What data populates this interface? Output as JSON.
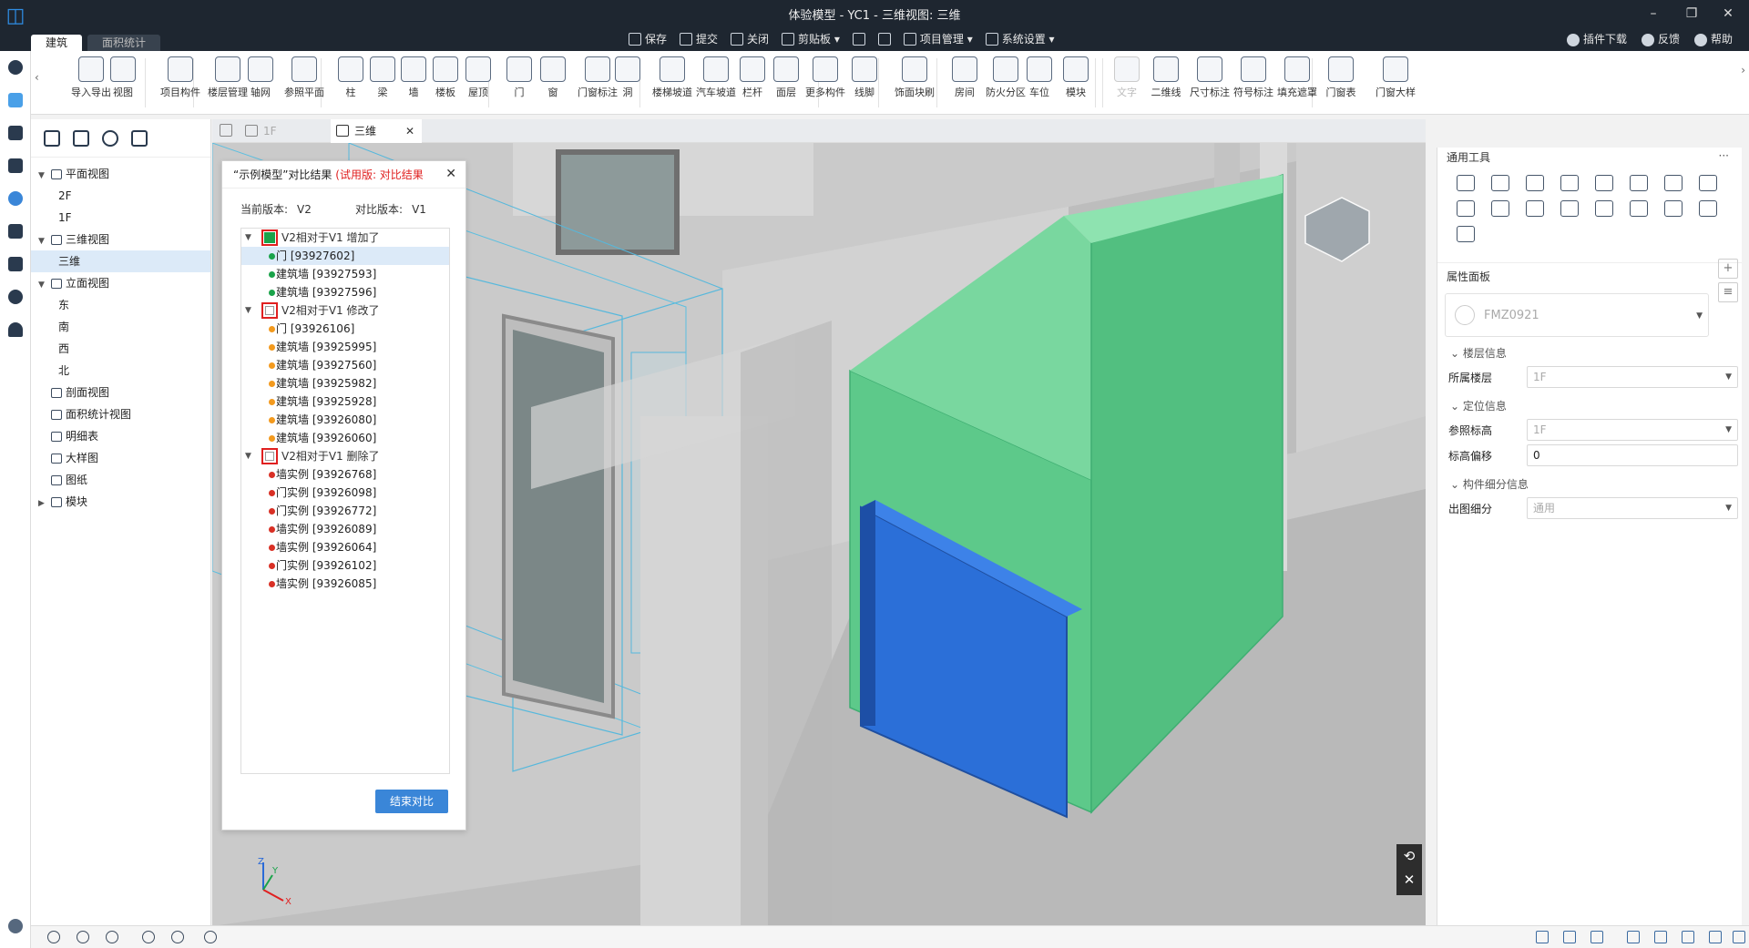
{
  "window": {
    "title": "体验模型 - YC1 - 三维视图: 三维",
    "app_tabs": [
      "建筑",
      "面积统计"
    ]
  },
  "quickbar": [
    {
      "label": "保存",
      "icon": "save-icon"
    },
    {
      "label": "提交",
      "icon": "submit-icon"
    },
    {
      "label": "关闭",
      "icon": "close-file-icon"
    },
    {
      "label": "剪贴板 ▾",
      "icon": "clipboard-icon"
    },
    {
      "label": "",
      "icon": "undo-icon"
    },
    {
      "label": "",
      "icon": "redo-icon"
    },
    {
      "label": "项目管理 ▾",
      "icon": "project-icon"
    },
    {
      "label": "系统设置 ▾",
      "icon": "settings-icon"
    }
  ],
  "right_links": [
    "插件下载",
    "反馈",
    "帮助"
  ],
  "ribbon": {
    "items": [
      "导入导出",
      "视图",
      "项目构件",
      "楼层管理",
      "轴网",
      "参照平面",
      "柱",
      "梁",
      "墙",
      "楼板",
      "屋顶",
      "门",
      "窗",
      "门窗标注",
      "洞",
      "楼梯坡道",
      "汽车坡道",
      "栏杆",
      "面层",
      "更多构件",
      "线脚",
      "饰面块刷",
      "房间",
      "防火分区",
      "车位",
      "模块",
      "文字",
      "二维线",
      "尺寸标注",
      "符号标注",
      "填充遮罩",
      "门窗表",
      "门窗大样"
    ],
    "disabled": [
      "文字"
    ]
  },
  "tree": {
    "nodes": [
      {
        "label": "平面视图",
        "level": 0,
        "arrow": "▼"
      },
      {
        "label": "2F",
        "level": 1
      },
      {
        "label": "1F",
        "level": 1
      },
      {
        "label": "三维视图",
        "level": 0,
        "arrow": "▼"
      },
      {
        "label": "三维",
        "level": 1,
        "selected": true
      },
      {
        "label": "立面视图",
        "level": 0,
        "arrow": "▼"
      },
      {
        "label": "东",
        "level": 1
      },
      {
        "label": "南",
        "level": 1
      },
      {
        "label": "西",
        "level": 1
      },
      {
        "label": "北",
        "level": 1
      },
      {
        "label": "剖面视图",
        "level": 0
      },
      {
        "label": "面积统计视图",
        "level": 0
      },
      {
        "label": "明细表",
        "level": 0
      },
      {
        "label": "大样图",
        "level": 0
      },
      {
        "label": "图纸",
        "level": 0
      },
      {
        "label": "模块",
        "level": 0,
        "arrow": "▶"
      }
    ]
  },
  "doc_tabs": {
    "tab1": "1F",
    "tab2": "三维",
    "close": "✕"
  },
  "compare": {
    "title_a": "“示例模型”对比结果",
    "title_b": "(试用版: 对比结果",
    "close": "✕",
    "current_label": "当前版本:",
    "current_value": "V2",
    "compare_label": "对比版本:",
    "compare_value": "V1",
    "groups": [
      {
        "label": "V2相对于V1 增加了",
        "checked": true,
        "color": "#1aa34a",
        "items": [
          "门 [93927602]",
          "建筑墙 [93927593]",
          "建筑墙 [93927596]"
        ]
      },
      {
        "label": "V2相对于V1 修改了",
        "checked": false,
        "color": "#f39a1e",
        "items": [
          "门 [93926106]",
          "建筑墙 [93925995]",
          "建筑墙 [93927560]",
          "建筑墙 [93925982]",
          "建筑墙 [93925928]",
          "建筑墙 [93926080]",
          "建筑墙 [93926060]"
        ]
      },
      {
        "label": "V2相对于V1 删除了",
        "checked": false,
        "color": "#d93025",
        "items": [
          "墙实例 [93926768]",
          "门实例 [93926098]",
          "门实例 [93926772]",
          "墙实例 [93926089]",
          "墙实例 [93926064]",
          "门实例 [93926102]",
          "墙实例 [93926085]"
        ]
      }
    ],
    "end_button": "结束对比"
  },
  "right_panel": {
    "tools_title": "通用工具",
    "more": "···",
    "props_title": "属性面板",
    "type_value": "FMZ0921",
    "sections": [
      {
        "title": "楼层信息",
        "rows": [
          {
            "label": "所属楼层",
            "value": "1F",
            "dropdown": true
          }
        ]
      },
      {
        "title": "定位信息",
        "rows": [
          {
            "label": "参照标高",
            "value": "1F",
            "dropdown": true
          },
          {
            "label": "标高偏移",
            "value": "0",
            "dropdown": false
          }
        ]
      },
      {
        "title": "构件细分信息",
        "rows": [
          {
            "label": "出图细分",
            "value": "通用",
            "dropdown": true
          }
        ]
      }
    ]
  },
  "axis": {
    "z": "Z",
    "y": "Y",
    "x": "X"
  },
  "colors": {
    "added": "#1aa34a",
    "modified": "#f39a1e",
    "deleted": "#d93025",
    "accent": "#3a86d8",
    "added_wall": "#5dc98a",
    "added_door": "#2b6fd8"
  }
}
